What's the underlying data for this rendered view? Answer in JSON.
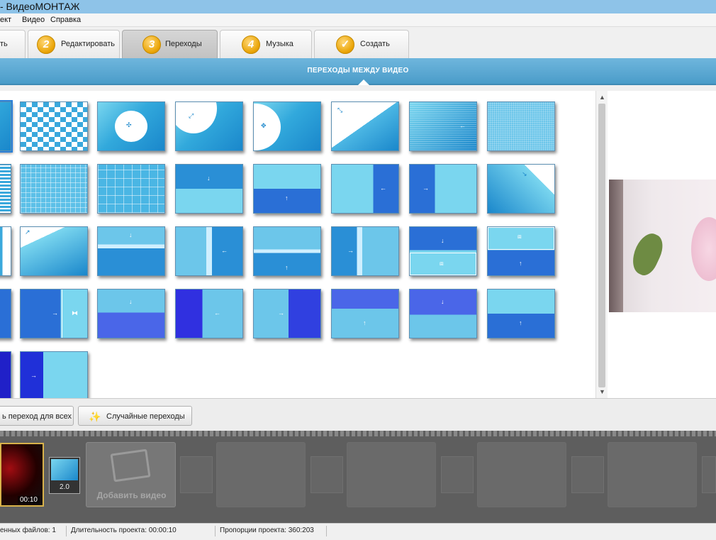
{
  "window": {
    "title": "- ВидеоМОНТАЖ"
  },
  "menu": [
    "ект",
    "Видео",
    "Справка"
  ],
  "tabs": [
    {
      "num": "",
      "label": "ть"
    },
    {
      "num": "2",
      "label": "Редактировать"
    },
    {
      "num": "3",
      "label": "Переходы"
    },
    {
      "num": "4",
      "label": "Музыка"
    },
    {
      "num": "",
      "label": "Создать"
    }
  ],
  "banner": "ПЕРЕХОДЫ МЕЖДУ ВИДЕО",
  "toolbar": {
    "apply_all": "ь переход для всех",
    "random": "Случайные переходы"
  },
  "timeline": {
    "clip_duration": "00:10",
    "transition_duration": "2.0",
    "add_video": "Добавить видео"
  },
  "status": {
    "files": "енных файлов: 1",
    "duration": "Длительность проекта:  00:00:10",
    "proportions": "Пропорции проекта:  360:203"
  },
  "colors": {
    "accent": "#4a9cc9",
    "tab_badge": "#e9a200"
  }
}
